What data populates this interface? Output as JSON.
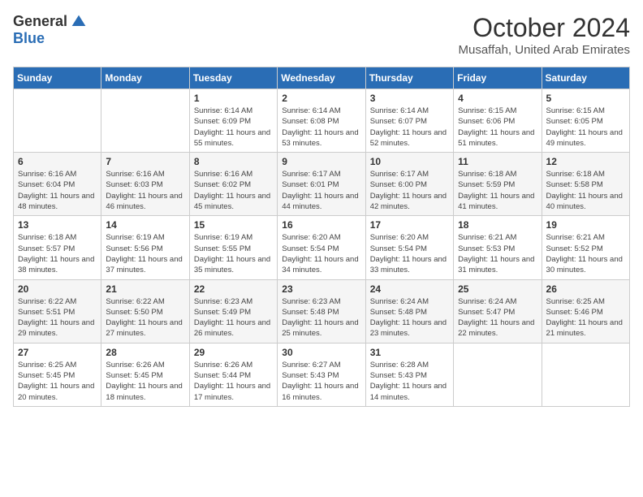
{
  "logo": {
    "general": "General",
    "blue": "Blue"
  },
  "header": {
    "month": "October 2024",
    "location": "Musaffah, United Arab Emirates"
  },
  "weekdays": [
    "Sunday",
    "Monday",
    "Tuesday",
    "Wednesday",
    "Thursday",
    "Friday",
    "Saturday"
  ],
  "weeks": [
    [
      {
        "day": "",
        "sunrise": "",
        "sunset": "",
        "daylight": ""
      },
      {
        "day": "",
        "sunrise": "",
        "sunset": "",
        "daylight": ""
      },
      {
        "day": "1",
        "sunrise": "Sunrise: 6:14 AM",
        "sunset": "Sunset: 6:09 PM",
        "daylight": "Daylight: 11 hours and 55 minutes."
      },
      {
        "day": "2",
        "sunrise": "Sunrise: 6:14 AM",
        "sunset": "Sunset: 6:08 PM",
        "daylight": "Daylight: 11 hours and 53 minutes."
      },
      {
        "day": "3",
        "sunrise": "Sunrise: 6:14 AM",
        "sunset": "Sunset: 6:07 PM",
        "daylight": "Daylight: 11 hours and 52 minutes."
      },
      {
        "day": "4",
        "sunrise": "Sunrise: 6:15 AM",
        "sunset": "Sunset: 6:06 PM",
        "daylight": "Daylight: 11 hours and 51 minutes."
      },
      {
        "day": "5",
        "sunrise": "Sunrise: 6:15 AM",
        "sunset": "Sunset: 6:05 PM",
        "daylight": "Daylight: 11 hours and 49 minutes."
      }
    ],
    [
      {
        "day": "6",
        "sunrise": "Sunrise: 6:16 AM",
        "sunset": "Sunset: 6:04 PM",
        "daylight": "Daylight: 11 hours and 48 minutes."
      },
      {
        "day": "7",
        "sunrise": "Sunrise: 6:16 AM",
        "sunset": "Sunset: 6:03 PM",
        "daylight": "Daylight: 11 hours and 46 minutes."
      },
      {
        "day": "8",
        "sunrise": "Sunrise: 6:16 AM",
        "sunset": "Sunset: 6:02 PM",
        "daylight": "Daylight: 11 hours and 45 minutes."
      },
      {
        "day": "9",
        "sunrise": "Sunrise: 6:17 AM",
        "sunset": "Sunset: 6:01 PM",
        "daylight": "Daylight: 11 hours and 44 minutes."
      },
      {
        "day": "10",
        "sunrise": "Sunrise: 6:17 AM",
        "sunset": "Sunset: 6:00 PM",
        "daylight": "Daylight: 11 hours and 42 minutes."
      },
      {
        "day": "11",
        "sunrise": "Sunrise: 6:18 AM",
        "sunset": "Sunset: 5:59 PM",
        "daylight": "Daylight: 11 hours and 41 minutes."
      },
      {
        "day": "12",
        "sunrise": "Sunrise: 6:18 AM",
        "sunset": "Sunset: 5:58 PM",
        "daylight": "Daylight: 11 hours and 40 minutes."
      }
    ],
    [
      {
        "day": "13",
        "sunrise": "Sunrise: 6:18 AM",
        "sunset": "Sunset: 5:57 PM",
        "daylight": "Daylight: 11 hours and 38 minutes."
      },
      {
        "day": "14",
        "sunrise": "Sunrise: 6:19 AM",
        "sunset": "Sunset: 5:56 PM",
        "daylight": "Daylight: 11 hours and 37 minutes."
      },
      {
        "day": "15",
        "sunrise": "Sunrise: 6:19 AM",
        "sunset": "Sunset: 5:55 PM",
        "daylight": "Daylight: 11 hours and 35 minutes."
      },
      {
        "day": "16",
        "sunrise": "Sunrise: 6:20 AM",
        "sunset": "Sunset: 5:54 PM",
        "daylight": "Daylight: 11 hours and 34 minutes."
      },
      {
        "day": "17",
        "sunrise": "Sunrise: 6:20 AM",
        "sunset": "Sunset: 5:54 PM",
        "daylight": "Daylight: 11 hours and 33 minutes."
      },
      {
        "day": "18",
        "sunrise": "Sunrise: 6:21 AM",
        "sunset": "Sunset: 5:53 PM",
        "daylight": "Daylight: 11 hours and 31 minutes."
      },
      {
        "day": "19",
        "sunrise": "Sunrise: 6:21 AM",
        "sunset": "Sunset: 5:52 PM",
        "daylight": "Daylight: 11 hours and 30 minutes."
      }
    ],
    [
      {
        "day": "20",
        "sunrise": "Sunrise: 6:22 AM",
        "sunset": "Sunset: 5:51 PM",
        "daylight": "Daylight: 11 hours and 29 minutes."
      },
      {
        "day": "21",
        "sunrise": "Sunrise: 6:22 AM",
        "sunset": "Sunset: 5:50 PM",
        "daylight": "Daylight: 11 hours and 27 minutes."
      },
      {
        "day": "22",
        "sunrise": "Sunrise: 6:23 AM",
        "sunset": "Sunset: 5:49 PM",
        "daylight": "Daylight: 11 hours and 26 minutes."
      },
      {
        "day": "23",
        "sunrise": "Sunrise: 6:23 AM",
        "sunset": "Sunset: 5:48 PM",
        "daylight": "Daylight: 11 hours and 25 minutes."
      },
      {
        "day": "24",
        "sunrise": "Sunrise: 6:24 AM",
        "sunset": "Sunset: 5:48 PM",
        "daylight": "Daylight: 11 hours and 23 minutes."
      },
      {
        "day": "25",
        "sunrise": "Sunrise: 6:24 AM",
        "sunset": "Sunset: 5:47 PM",
        "daylight": "Daylight: 11 hours and 22 minutes."
      },
      {
        "day": "26",
        "sunrise": "Sunrise: 6:25 AM",
        "sunset": "Sunset: 5:46 PM",
        "daylight": "Daylight: 11 hours and 21 minutes."
      }
    ],
    [
      {
        "day": "27",
        "sunrise": "Sunrise: 6:25 AM",
        "sunset": "Sunset: 5:45 PM",
        "daylight": "Daylight: 11 hours and 20 minutes."
      },
      {
        "day": "28",
        "sunrise": "Sunrise: 6:26 AM",
        "sunset": "Sunset: 5:45 PM",
        "daylight": "Daylight: 11 hours and 18 minutes."
      },
      {
        "day": "29",
        "sunrise": "Sunrise: 6:26 AM",
        "sunset": "Sunset: 5:44 PM",
        "daylight": "Daylight: 11 hours and 17 minutes."
      },
      {
        "day": "30",
        "sunrise": "Sunrise: 6:27 AM",
        "sunset": "Sunset: 5:43 PM",
        "daylight": "Daylight: 11 hours and 16 minutes."
      },
      {
        "day": "31",
        "sunrise": "Sunrise: 6:28 AM",
        "sunset": "Sunset: 5:43 PM",
        "daylight": "Daylight: 11 hours and 14 minutes."
      },
      {
        "day": "",
        "sunrise": "",
        "sunset": "",
        "daylight": ""
      },
      {
        "day": "",
        "sunrise": "",
        "sunset": "",
        "daylight": ""
      }
    ]
  ]
}
